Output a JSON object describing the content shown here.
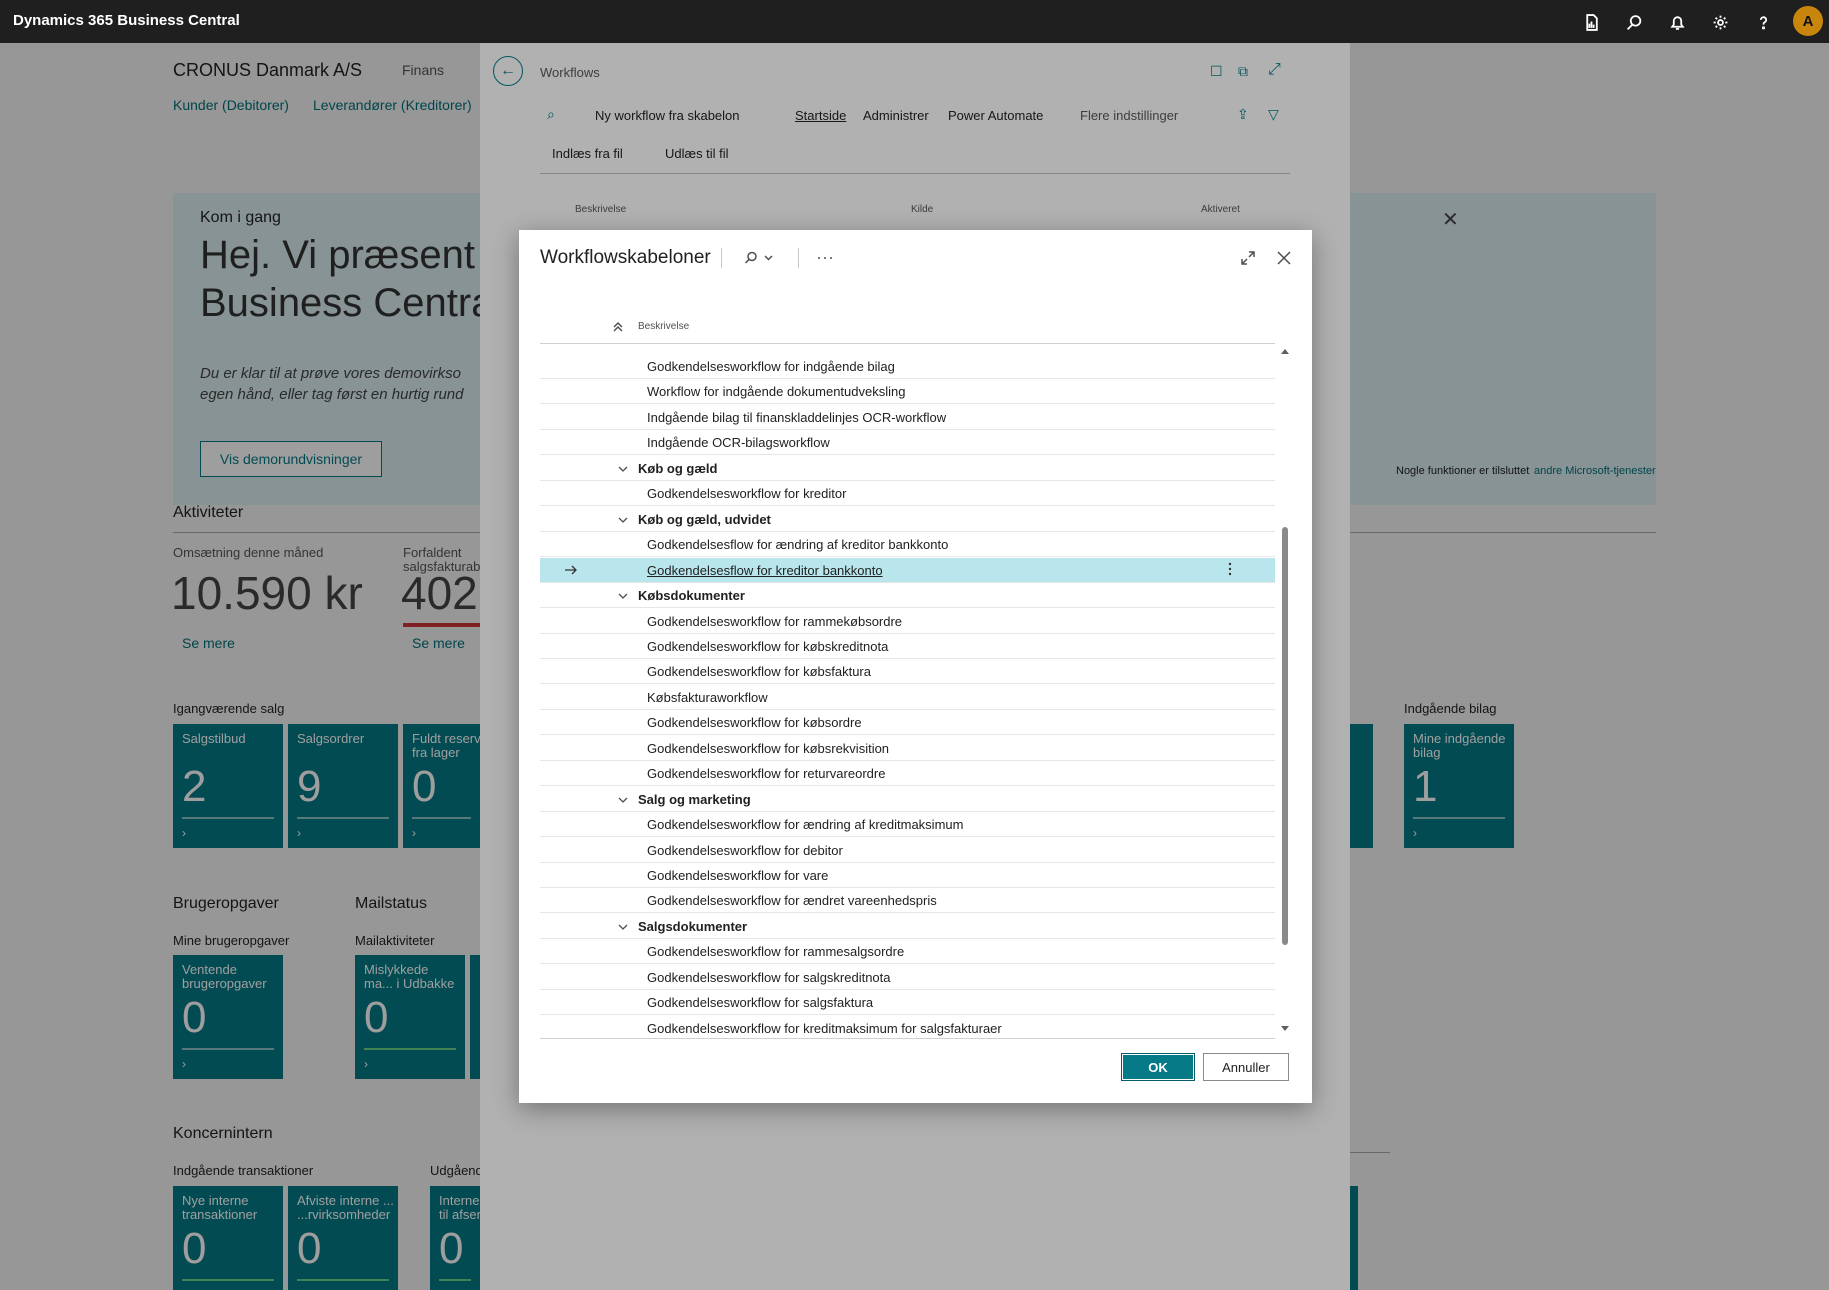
{
  "app": {
    "title": "Dynamics 365 Business Central",
    "avatar": "A"
  },
  "background": {
    "company": "CRONUS Danmark A/S",
    "menu": "Finans",
    "nav_links": [
      "Kunder (Debitorer)",
      "Leverandører (Kreditorer)"
    ],
    "hero": {
      "kicker": "Kom i gang",
      "heading1": "Hej. Vi præsent",
      "heading2": "Business Centra",
      "body1": "Du er klar til at prøve vores demovirkso",
      "body2": "egen hånd, eller tag først en hurtig rund",
      "button": "Vis demorundvisninger",
      "note": "Nogle funktioner er tilsluttet",
      "note_link": "andre Microsoft-tjenester"
    },
    "activities": {
      "title": "Aktiviteter",
      "kpi1_label": "Omsætning denne måned",
      "kpi1_value": "10.590 kr",
      "kpi2_label1": "Forfaldent",
      "kpi2_label2": "salgsfakturab",
      "kpi2_value": "402.",
      "see_more": "Se mere"
    },
    "ongoing_sales": {
      "title": "Igangværende salg",
      "tiles": [
        {
          "label": "Salgstilbud",
          "value": "2"
        },
        {
          "label": "Salgsordrer",
          "value": "9"
        },
        {
          "label": "Fuldt reserv fra lager",
          "value": "0"
        }
      ]
    },
    "incoming_docs": {
      "title": "Indgående bilag",
      "tile_label": "Mine indgående bilag",
      "tile_value": "1"
    },
    "user_tasks": {
      "title": "Brugeropgaver",
      "sub": "Mine brugeropgaver",
      "tile_label": "Ventende brugeropgaver",
      "tile_value": "0"
    },
    "mail": {
      "title": "Mailstatus",
      "sub": "Mailaktiviteter",
      "tile_label": "Mislykkede ma... i Udbakke",
      "tile_value": "0"
    },
    "intercompany": {
      "title": "Koncernintern",
      "sub1": "Indgående transaktioner",
      "sub2": "Udgåend",
      "tiles": [
        {
          "label": "Nye interne transaktioner",
          "value": "0"
        },
        {
          "label": "Afviste interne ... ...rvirksomheder",
          "value": "0"
        },
        {
          "label": "Interne til afsen",
          "value": "0"
        }
      ]
    }
  },
  "workflows_page": {
    "title": "Workflows",
    "actions": [
      "Ny workflow fra skabelon",
      "Startside",
      "Administrer",
      "Power Automate",
      "Flere indstillinger"
    ],
    "sub_actions": [
      "Indlæs fra fil",
      "Udlæs til fil"
    ],
    "columns": [
      "Beskrivelse",
      "Kilde",
      "Aktiveret"
    ]
  },
  "dialog": {
    "title": "Workflowskabeloner",
    "column": "Beskrivelse",
    "ok": "OK",
    "cancel": "Annuller",
    "rows": [
      {
        "text": "Godkendelsesworkflow for indgående bilag",
        "group": false
      },
      {
        "text": "Workflow for indgående dokumentudveksling",
        "group": false
      },
      {
        "text": "Indgående bilag til finanskladdelinjes OCR-workflow",
        "group": false
      },
      {
        "text": "Indgående OCR-bilagsworkflow",
        "group": false
      },
      {
        "text": "Køb og gæld",
        "group": true
      },
      {
        "text": "Godkendelsesworkflow for kreditor",
        "group": false
      },
      {
        "text": "Køb og gæld, udvidet",
        "group": true
      },
      {
        "text": "Godkendelsesflow for ændring af kreditor bankkonto",
        "group": false
      },
      {
        "text": "Godkendelsesflow for kreditor bankkonto",
        "group": false,
        "selected": true
      },
      {
        "text": "Købsdokumenter",
        "group": true
      },
      {
        "text": "Godkendelsesworkflow for rammekøbsordre",
        "group": false
      },
      {
        "text": "Godkendelsesworkflow for købskreditnota",
        "group": false
      },
      {
        "text": "Godkendelsesworkflow for købsfaktura",
        "group": false
      },
      {
        "text": "Købsfakturaworkflow",
        "group": false
      },
      {
        "text": "Godkendelsesworkflow for købsordre",
        "group": false
      },
      {
        "text": "Godkendelsesworkflow for købsrekvisition",
        "group": false
      },
      {
        "text": "Godkendelsesworkflow for returvareordre",
        "group": false
      },
      {
        "text": "Salg og marketing",
        "group": true
      },
      {
        "text": "Godkendelsesworkflow for ændring af kreditmaksimum",
        "group": false
      },
      {
        "text": "Godkendelsesworkflow for debitor",
        "group": false
      },
      {
        "text": "Godkendelsesworkflow for vare",
        "group": false
      },
      {
        "text": "Godkendelsesworkflow for ændret vareenhedspris",
        "group": false
      },
      {
        "text": "Salgsdokumenter",
        "group": true
      },
      {
        "text": "Godkendelsesworkflow for rammesalgsordre",
        "group": false
      },
      {
        "text": "Godkendelsesworkflow for salgskreditnota",
        "group": false
      },
      {
        "text": "Godkendelsesworkflow for salgsfaktura",
        "group": false
      },
      {
        "text": "Godkendelsesworkflow for kreditmaksimum for salgsfakturaer",
        "group": false
      }
    ]
  }
}
